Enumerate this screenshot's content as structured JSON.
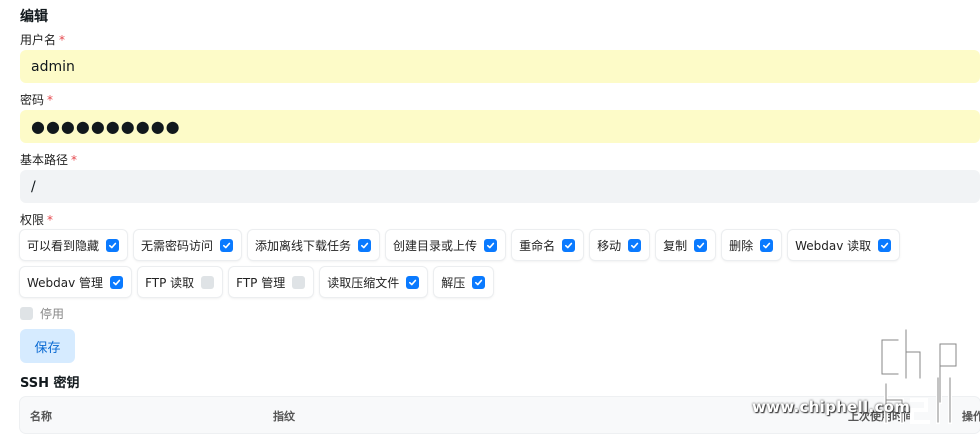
{
  "form": {
    "title": "编辑",
    "username": {
      "label": "用户名",
      "required": "*",
      "value": "admin"
    },
    "password": {
      "label": "密码",
      "required": "*",
      "value": "●●●●●●●●●●"
    },
    "base_path": {
      "label": "基本路径",
      "required": "*",
      "value": "/"
    },
    "permissions": {
      "label": "权限",
      "required": "*",
      "row1": [
        {
          "label": "可以看到隐藏",
          "checked": true
        },
        {
          "label": "无需密码访问",
          "checked": true
        },
        {
          "label": "添加离线下载任务",
          "checked": true
        },
        {
          "label": "创建目录或上传",
          "checked": true
        },
        {
          "label": "重命名",
          "checked": true
        },
        {
          "label": "移动",
          "checked": true
        },
        {
          "label": "复制",
          "checked": true
        },
        {
          "label": "删除",
          "checked": true
        },
        {
          "label": "Webdav 读取",
          "checked": true
        }
      ],
      "row2": [
        {
          "label": "Webdav 管理",
          "checked": true
        },
        {
          "label": "FTP 读取",
          "checked": false
        },
        {
          "label": "FTP 管理",
          "checked": false
        },
        {
          "label": "读取压缩文件",
          "checked": true
        },
        {
          "label": "解压",
          "checked": true
        }
      ]
    },
    "disabled": {
      "label": "停用",
      "checked": false
    },
    "save_label": "保存"
  },
  "ssh": {
    "title": "SSH 密钥",
    "columns": [
      "名称",
      "指纹",
      "上次使用时间",
      "操作"
    ]
  },
  "watermark": {
    "text": "www.chiphell.com"
  },
  "colors": {
    "accent": "#0a7aff",
    "autofill": "#fdfbc8",
    "required": "#e5484d"
  }
}
